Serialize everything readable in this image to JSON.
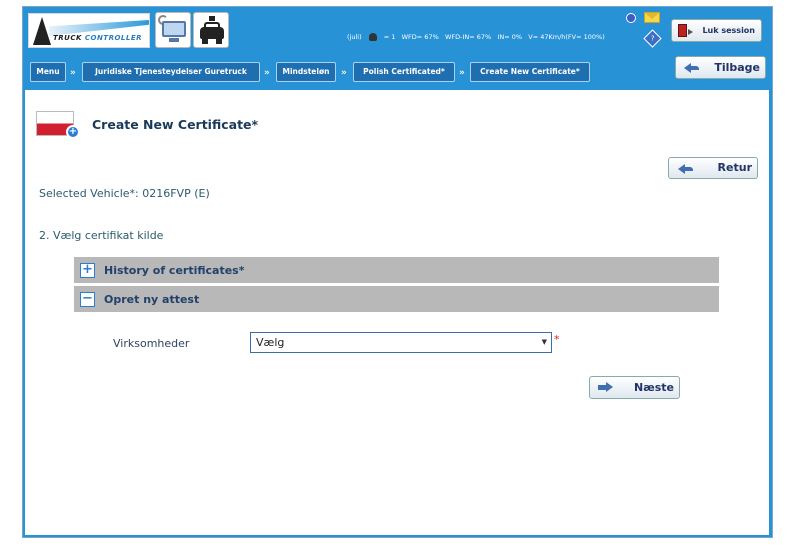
{
  "header": {
    "logo_text_part1": "TRUCK",
    "logo_text_part2": "CONTROLLER",
    "status": {
      "user": "(juli)",
      "driver_count": "= 1",
      "wfd": "WFD= 67%",
      "wfd_in": "WFD-IN= 67%",
      "in": "IN= 0%",
      "v": "V= 47Km/h(FV= 100%)"
    },
    "logout_label": "Luk session",
    "help_glyph": "?"
  },
  "breadcrumb": {
    "separator": "»",
    "items": [
      "Menu",
      "Juridiske Tjenesteydelser Guretruck",
      "Mindsteløn",
      "Polish Certificated*",
      "Create New Certificate*"
    ]
  },
  "back_top_label": "Tilbage",
  "main": {
    "title": "Create New Certificate*",
    "retur_label": "Retur",
    "selected_vehicle": "Selected Vehicle*: 0216FVP (E)",
    "step": "2. Vælg certifikat kilde",
    "accordions": [
      {
        "sign": "+",
        "label": "History of certificates*"
      },
      {
        "sign": "−",
        "label": "Opret ny attest"
      }
    ],
    "field_label": "Virksomheder",
    "select_value": "Vælg",
    "select_arrow": "▼",
    "required_mark": "*",
    "next_label": "Næste"
  },
  "icons": [
    "info-icon",
    "mail-icon",
    "help-icon",
    "logout-door-icon",
    "monitor-satellite-icon",
    "police-car-icon",
    "poland-flag-icon",
    "add-icon",
    "back-arrow-icon",
    "next-arrow-icon"
  ],
  "colors": {
    "header_blue": "#2792d6",
    "crumb_blue": "#1f6fb0",
    "accordion_gray": "#b8b8b8",
    "title_navy": "#1b3a5a",
    "required_red": "#e02020"
  }
}
